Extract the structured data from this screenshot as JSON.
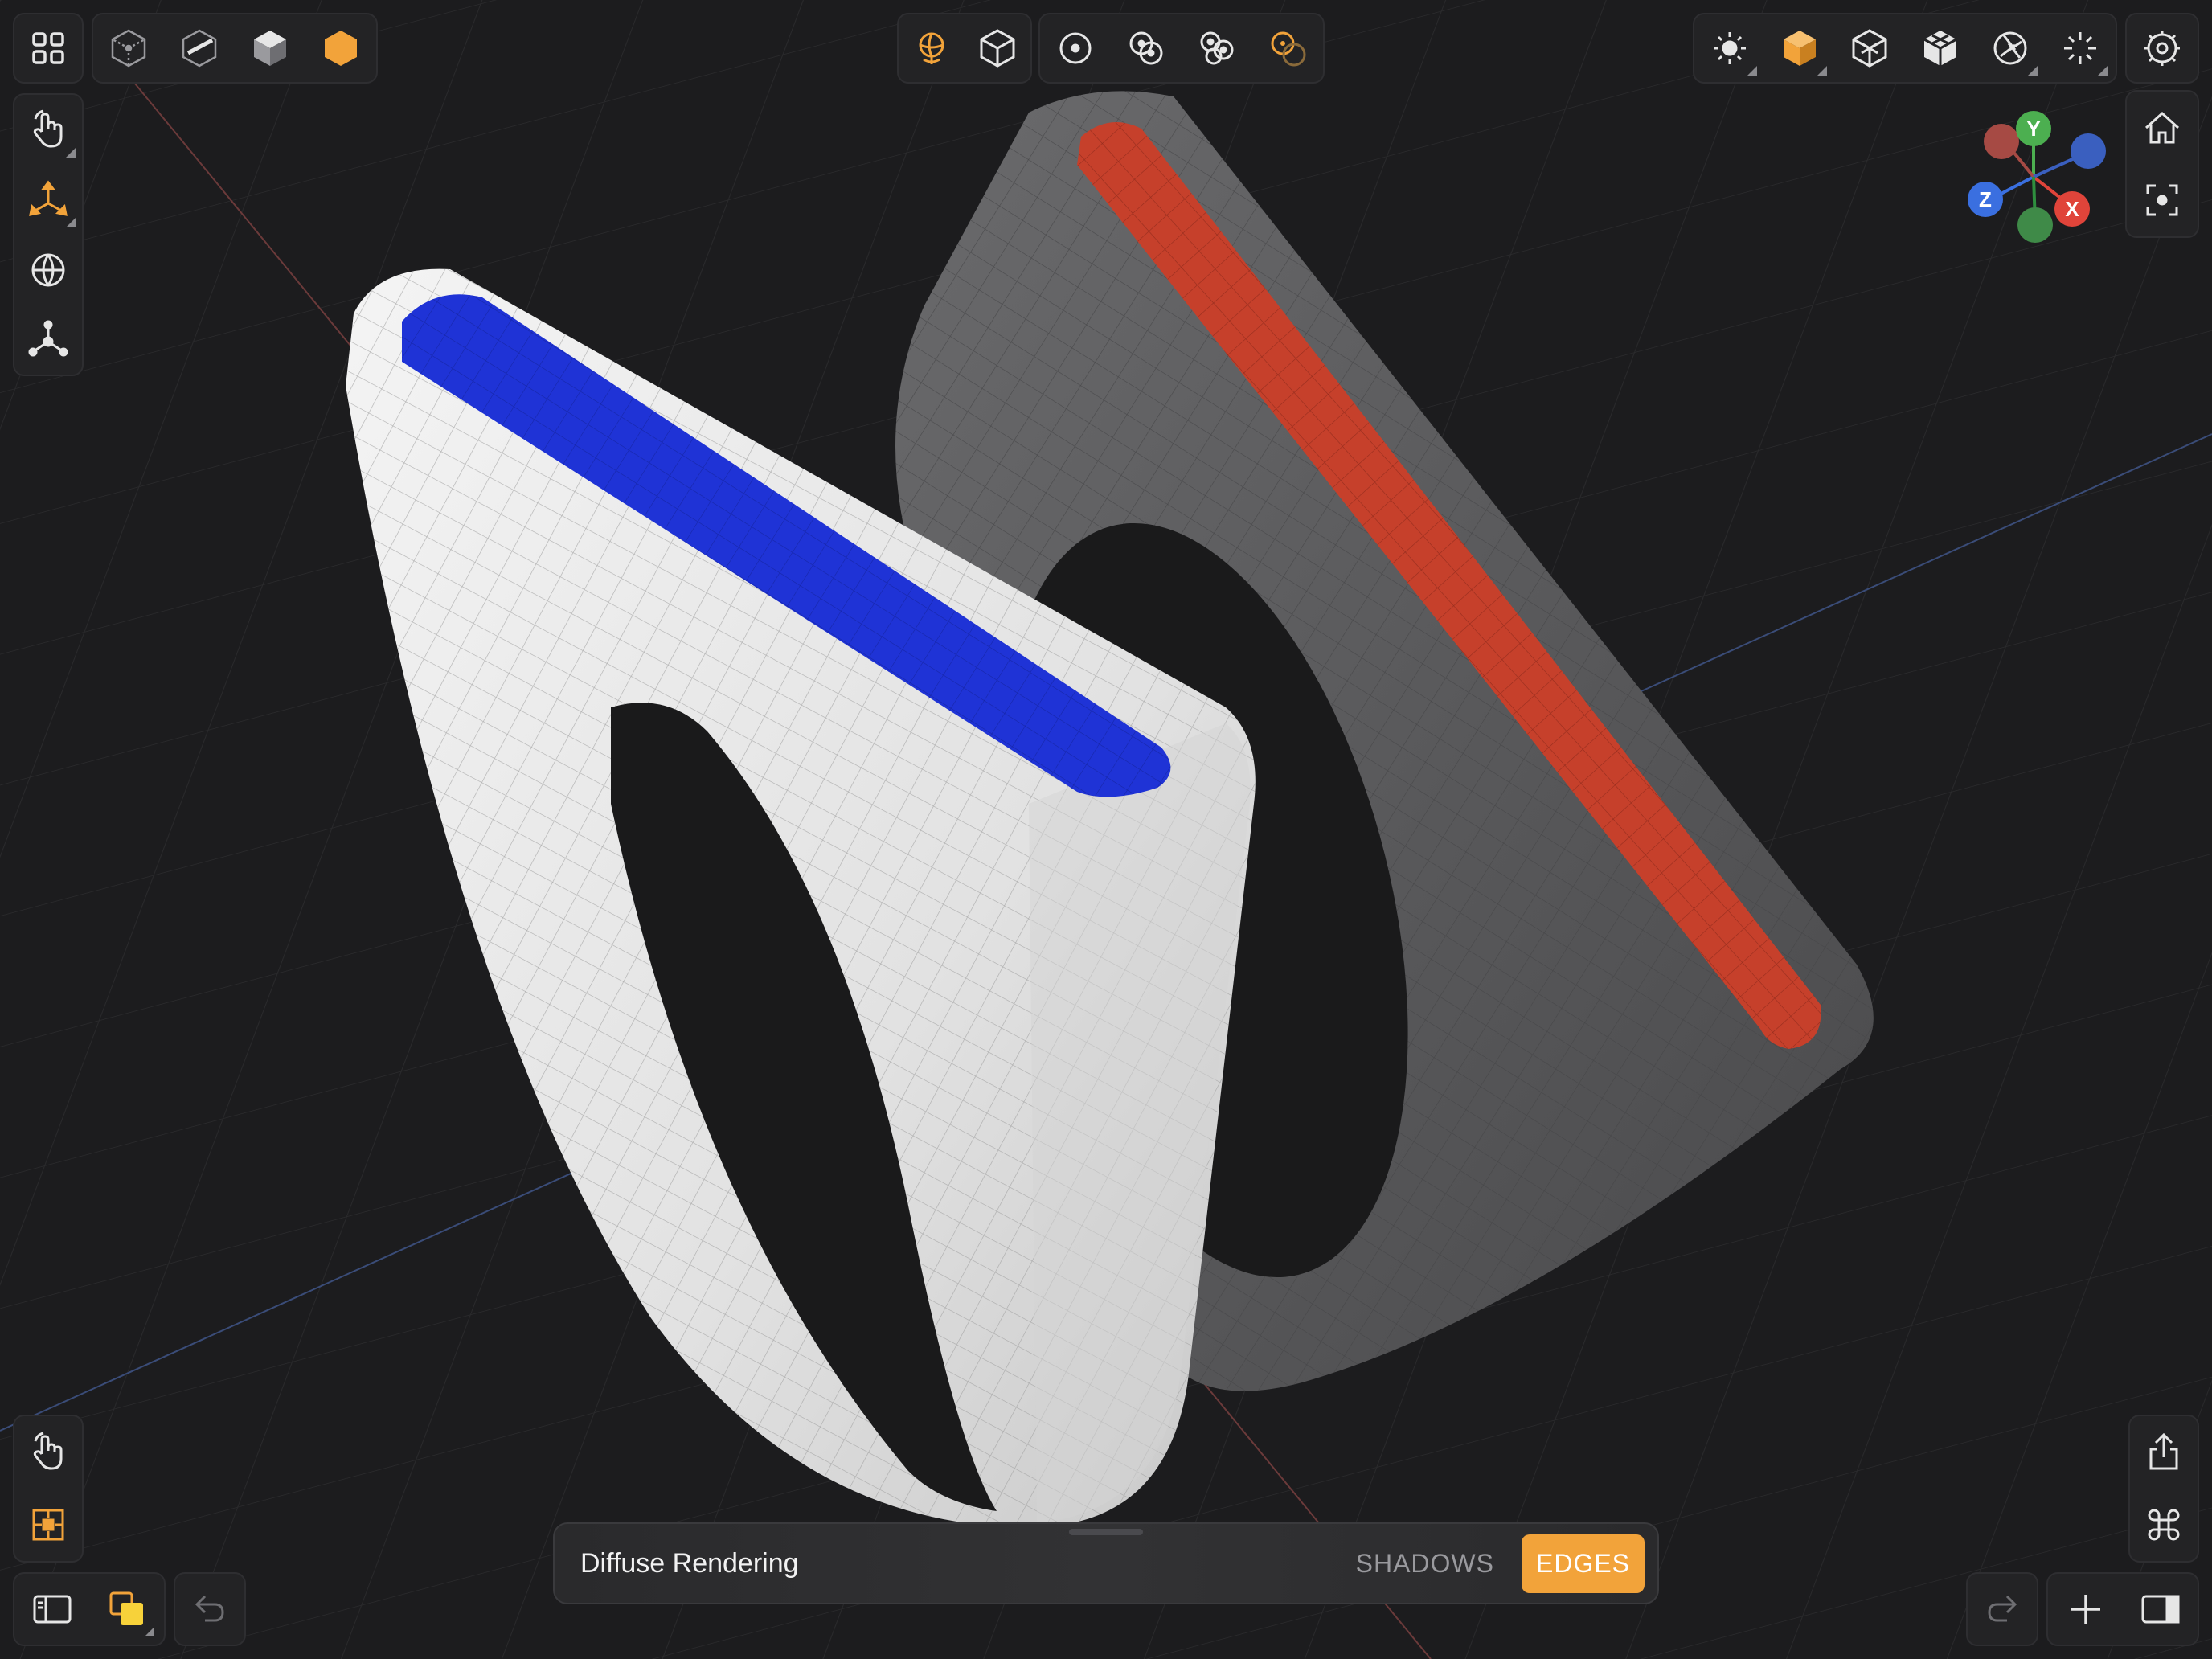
{
  "viewport": {
    "scene_objects": [
      {
        "name": "white-ring",
        "inlay_color": "#1f33d6",
        "body_color": "#e9e9e9"
      },
      {
        "name": "gray-ring",
        "inlay_color": "#c6402b",
        "body_color": "#5c5c5e"
      }
    ]
  },
  "toolbars": {
    "top_left": {
      "icons": [
        "grid-menu-icon",
        "wireframe-cube-icon",
        "xray-cube-icon",
        "solid-cube-icon",
        "shaded-hexagon-icon"
      ],
      "active": "shaded-hexagon-icon"
    },
    "top_center": {
      "icons": [
        "environment-globe-icon",
        "object-cube-icon",
        "single-circle-icon",
        "two-circles-icon",
        "three-circles-icon",
        "linked-circles-icon"
      ],
      "active": [
        "environment-globe-icon"
      ]
    },
    "top_right": {
      "icons": [
        "sun-light-icon",
        "material-cube-icon",
        "wire-cube-icon",
        "mesh-cube-icon",
        "aperture-icon",
        "sparkle-icon",
        "settings-gear-icon"
      ],
      "active": "material-cube-icon"
    },
    "left": {
      "icons": [
        "touch-hand-icon",
        "transform-axes-icon",
        "sphere-icon",
        "pivot-nodes-icon"
      ]
    },
    "right": {
      "icons": [
        "home-icon",
        "focus-frame-icon"
      ]
    },
    "bottom_left": {
      "icons": [
        "touch-hand-icon",
        "snap-grid-icon",
        "sidebar-left-icon",
        "layers-icon",
        "undo-icon"
      ]
    },
    "bottom_right": {
      "icons": [
        "share-icon",
        "command-icon",
        "redo-icon",
        "add-icon",
        "sidebar-right-icon"
      ]
    }
  },
  "axis_gizmo": {
    "labels": [
      "Y",
      "Z",
      "X"
    ],
    "colors": {
      "x": "#e0443a",
      "y": "#4caf50",
      "z": "#3a6fe0"
    }
  },
  "render_panel": {
    "title": "Diffuse Rendering",
    "shadows_label": "SHADOWS",
    "edges_label": "EDGES",
    "active_option": "EDGES"
  },
  "accent_color": "#f2a33a"
}
